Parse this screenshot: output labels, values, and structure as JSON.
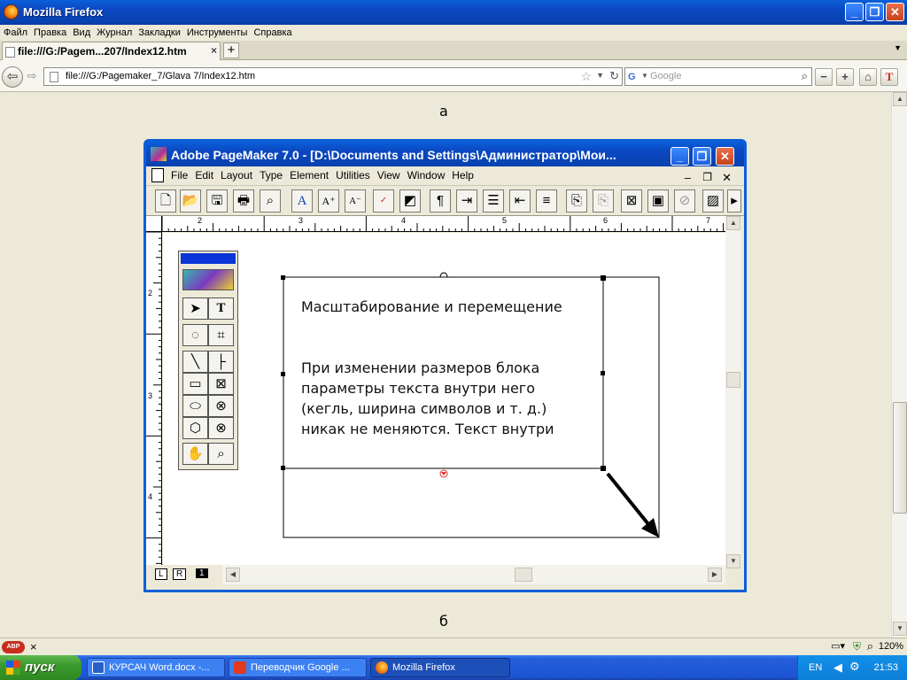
{
  "browser": {
    "window_title": "Mozilla Firefox",
    "menu": [
      "Файл",
      "Правка",
      "Вид",
      "Журнал",
      "Закладки",
      "Инструменты",
      "Справка"
    ],
    "tab_title": "file:///G:/Pagem...207/Index12.htm",
    "url": "file:///G:/Pagemaker_7/Glava 7/Index12.htm",
    "search_placeholder": "Google",
    "zoom_label": "120%"
  },
  "content": {
    "caption_top": "а",
    "caption_bottom": "б"
  },
  "pagemaker": {
    "title": "Adobe PageMaker 7.0 - [D:\\Documents and Settings\\Администратор\\Мои...",
    "menu": [
      "File",
      "Edit",
      "Layout",
      "Type",
      "Element",
      "Utilities",
      "View",
      "Window",
      "Help"
    ],
    "ruler_top_labels": [
      "2",
      "3",
      "4",
      "5",
      "6",
      "7"
    ],
    "ruler_left_labels": [
      "2",
      "3",
      "4"
    ],
    "page_tabs": [
      "L",
      "R",
      "1"
    ],
    "text_heading": "Масштабирование и перемещение",
    "text_body_lines": [
      "При изменении размеров блока",
      "параметры текста внутри него",
      "(кегль, ширина символов и т. д.)",
      "никак не меняются. Текст внутри"
    ]
  },
  "taskbar": {
    "start_label": "пуск",
    "tasks": [
      {
        "label": "КУРСАЧ Word.docx -...",
        "active": false
      },
      {
        "label": "Переводчик Google ...",
        "active": false
      },
      {
        "label": "Mozilla Firefox",
        "active": true
      }
    ],
    "lang": "EN",
    "clock": "21:53"
  },
  "colors": {
    "xp_blue": "#0b47c1",
    "taskbar_blue": "#245edb",
    "start_green": "#3a9a2e",
    "pm_toolbox_title": "#0a35d8"
  }
}
